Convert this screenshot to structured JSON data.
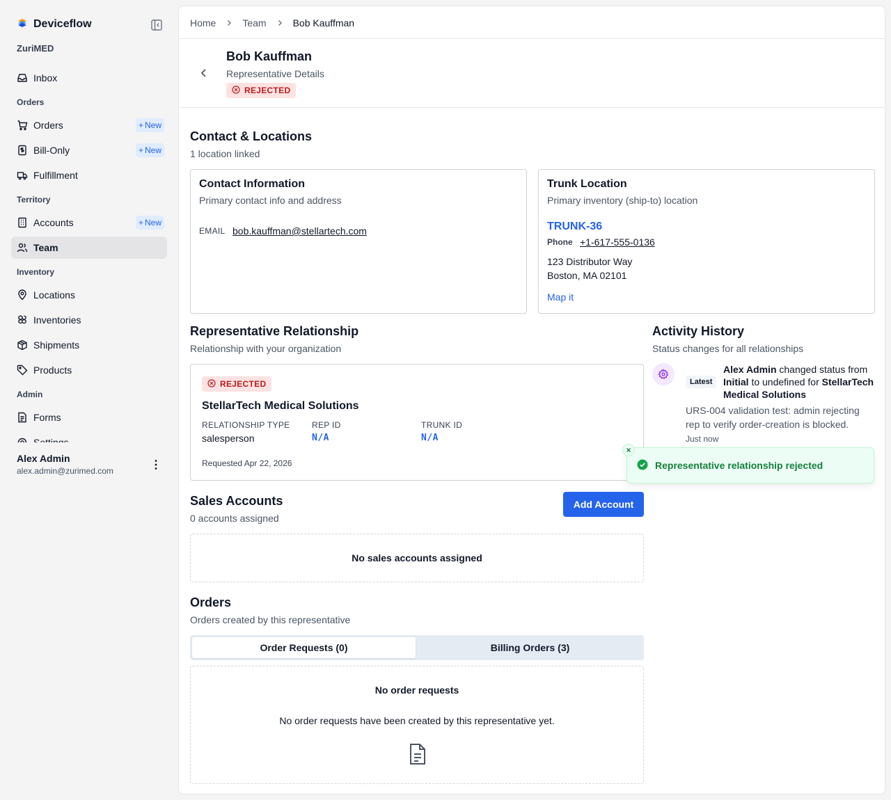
{
  "app": {
    "name": "Deviceflow",
    "org": "ZuriMED"
  },
  "sidebar": {
    "inbox": "Inbox",
    "sections": {
      "orders": "Orders",
      "territory": "Territory",
      "inventory": "Inventory",
      "admin": "Admin"
    },
    "items": {
      "orders": "Orders",
      "bill_only": "Bill-Only",
      "fulfillment": "Fulfillment",
      "accounts": "Accounts",
      "team": "Team",
      "locations": "Locations",
      "inventories": "Inventories",
      "shipments": "Shipments",
      "products": "Products",
      "forms": "Forms",
      "settings": "Settings"
    },
    "new_label": "New",
    "active_item": "Team"
  },
  "user": {
    "name": "Alex Admin",
    "email": "alex.admin@zurimed.com"
  },
  "breadcrumb": [
    "Home",
    "Team",
    "Bob Kauffman"
  ],
  "header": {
    "title": "Bob Kauffman",
    "subtitle": "Representative Details",
    "status": "REJECTED"
  },
  "contact_section": {
    "title": "Contact & Locations",
    "subtitle": "1 location linked",
    "contact_card": {
      "title": "Contact Information",
      "subtitle": "Primary contact info and address",
      "email_label": "EMAIL",
      "email": "bob.kauffman@stellartech.com"
    },
    "trunk_card": {
      "title": "Trunk Location",
      "subtitle": "Primary inventory (ship-to) location",
      "code": "TRUNK-36",
      "phone_label": "Phone",
      "phone": "+1-617-555-0136",
      "address_line1": "123 Distributor Way",
      "address_line2": "Boston, MA 02101",
      "map_link": "Map it"
    }
  },
  "relationship": {
    "title": "Representative Relationship",
    "subtitle": "Relationship with your organization",
    "status": "REJECTED",
    "org": "StellarTech Medical Solutions",
    "fields": {
      "type_label": "RELATIONSHIP TYPE",
      "type_value": "salesperson",
      "rep_label": "REP ID",
      "rep_value": "N/A",
      "trunk_label": "TRUNK ID",
      "trunk_value": "N/A"
    },
    "requested": "Requested Apr 22, 2026"
  },
  "activity": {
    "title": "Activity History",
    "subtitle": "Status changes for all relationships",
    "latest_label": "Latest",
    "entry": {
      "actor": "Alex Admin",
      "text1": " changed status from ",
      "from": "Initial",
      "text2": " to undefined for ",
      "target": "StellarTech Medical Solutions",
      "note": "URS-004 validation test: admin rejecting rep to verify order-creation is blocked.",
      "time": "Just now"
    }
  },
  "sales_accounts": {
    "title": "Sales Accounts",
    "subtitle": "0 accounts assigned",
    "add_button": "Add Account",
    "empty": "No sales accounts assigned"
  },
  "orders": {
    "title": "Orders",
    "subtitle": "Orders created by this representative",
    "tabs": [
      "Order Requests (0)",
      "Billing Orders (3)"
    ],
    "empty_title": "No order requests",
    "empty_text": "No order requests have been created by this representative yet."
  },
  "toast": {
    "message": "Representative relationship rejected"
  },
  "colors": {
    "primary": "#2563eb",
    "rejected_bg": "#fde2e2",
    "rejected_fg": "#b91c1c",
    "success": "#16a34a"
  }
}
